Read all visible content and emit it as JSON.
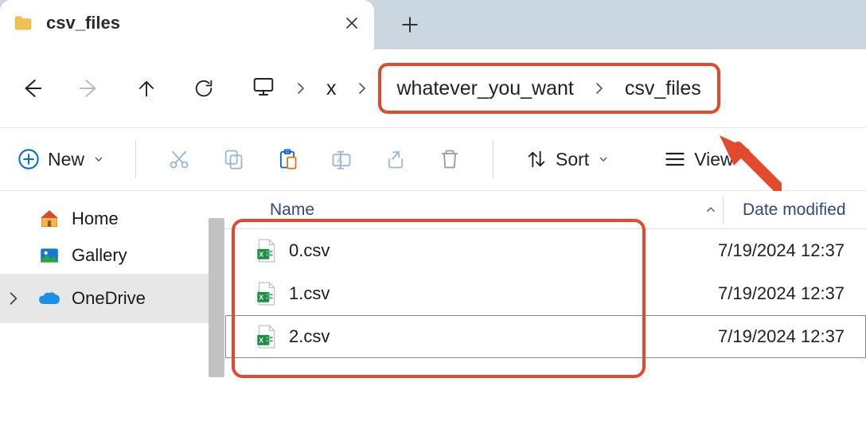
{
  "tab": {
    "title": "csv_files"
  },
  "breadcrumb": {
    "pc_label": "",
    "seg1": "x",
    "seg2": "whatever_you_want",
    "seg3": "csv_files"
  },
  "toolbar": {
    "new_label": "New",
    "sort_label": "Sort",
    "view_label": "View"
  },
  "sidebar": {
    "items": [
      {
        "label": "Home"
      },
      {
        "label": "Gallery"
      },
      {
        "label": "OneDrive"
      }
    ]
  },
  "columns": {
    "name": "Name",
    "date": "Date modified"
  },
  "files": [
    {
      "name": "0.csv",
      "date": "7/19/2024 12:37"
    },
    {
      "name": "1.csv",
      "date": "7/19/2024 12:37"
    },
    {
      "name": "2.csv",
      "date": "7/19/2024 12:37"
    }
  ]
}
